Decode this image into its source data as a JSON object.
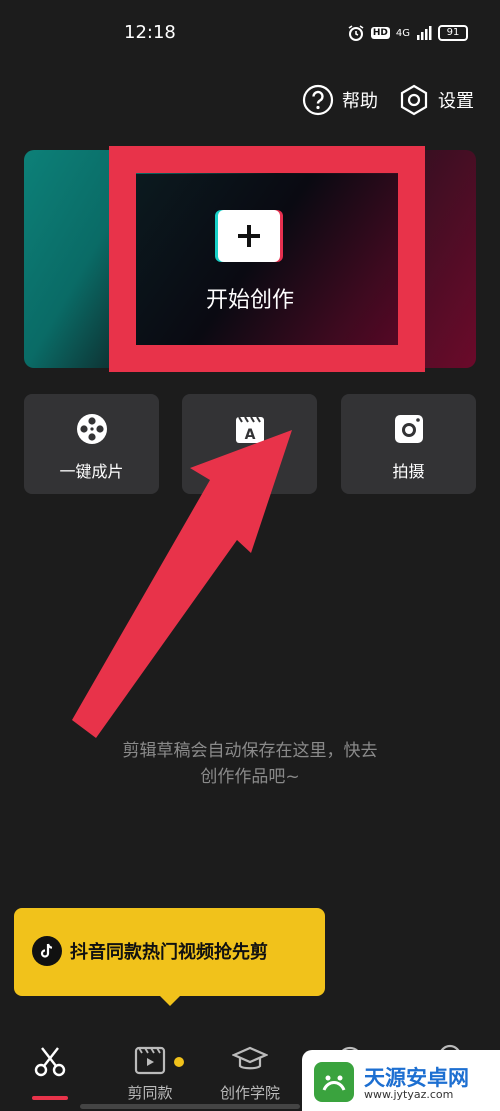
{
  "status": {
    "time": "12:18",
    "hd": "HD",
    "signal": "4G",
    "battery": "91"
  },
  "top": {
    "help_label": "帮助",
    "settings_label": "设置"
  },
  "hero": {
    "label": "开始创作"
  },
  "tiles": [
    {
      "label": "一键成片",
      "icon": "film-reel-icon"
    },
    {
      "label": "",
      "icon": "text-template-icon"
    },
    {
      "label": "拍摄",
      "icon": "camera-icon"
    }
  ],
  "empty_state": {
    "line1": "剪辑草稿会自动保存在这里，快去",
    "line2": "创作作品吧~"
  },
  "banner": {
    "text": "抖音同款热门视频抢先剪"
  },
  "tabs": [
    {
      "label": "",
      "icon": "scissors-icon",
      "active": true
    },
    {
      "label": "剪同款",
      "icon": "template-play-icon"
    },
    {
      "label": "创作学院",
      "icon": "graduation-cap-icon"
    },
    {
      "label": "",
      "icon": "message-icon"
    },
    {
      "label": "",
      "icon": "profile-icon"
    }
  ],
  "watermark": {
    "name": "天源安卓网",
    "url": "www.jytyaz.com"
  },
  "colors": {
    "accent": "#e8334a",
    "banner": "#f1c21b",
    "background": "#1c1c1c",
    "tile": "#333335"
  }
}
